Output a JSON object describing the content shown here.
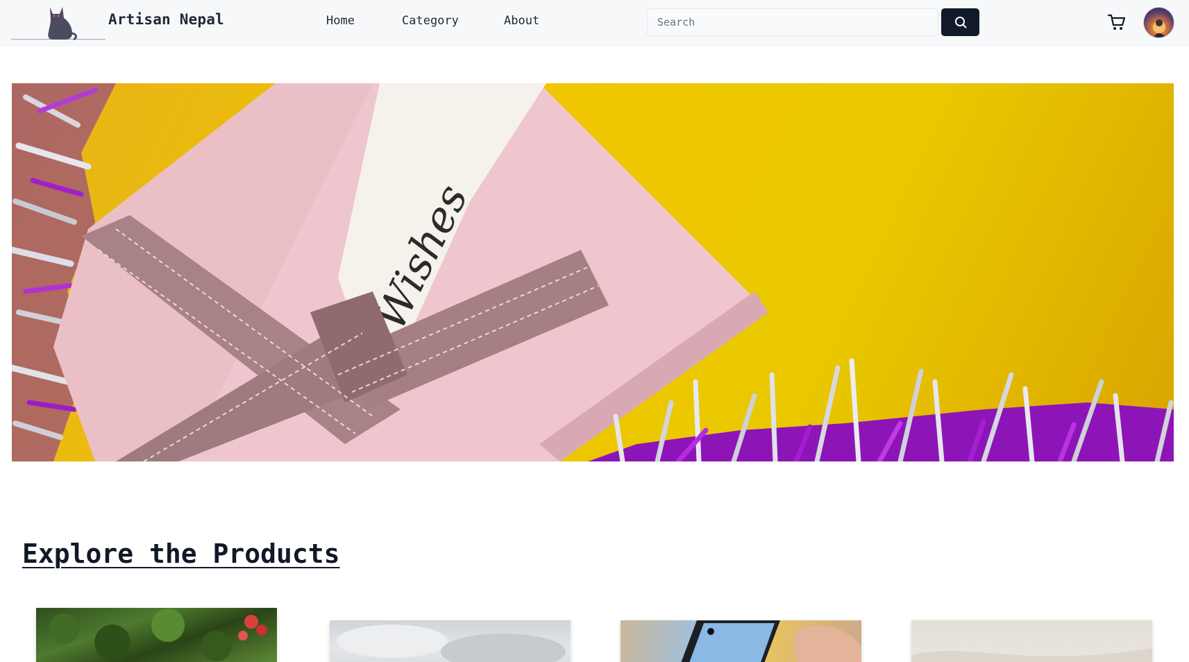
{
  "header": {
    "brand": "Artisan Nepal",
    "logo_icon": "cat-logo-icon",
    "nav": [
      {
        "label": "Home"
      },
      {
        "label": "Category"
      },
      {
        "label": "About"
      }
    ],
    "search": {
      "placeholder": "Search",
      "value": "",
      "button_icon": "search-icon"
    },
    "cart_icon": "cart-icon",
    "avatar_icon": "user-avatar"
  },
  "hero": {
    "image_text": "Wishes",
    "colors": {
      "background": "#f0c600",
      "box": "#efc4cc",
      "ribbon": "#a57f82",
      "tinsel": "#9b1fc7"
    }
  },
  "products_section": {
    "title": "Explore the Products",
    "cards": [
      {
        "image": "garden-flowers"
      },
      {
        "image": "cloudy-sky"
      },
      {
        "image": "phone-in-hand"
      },
      {
        "image": "light-fabric"
      }
    ]
  },
  "colors": {
    "accent": "#101a2b",
    "header_bg": "#f7f8fa",
    "text": "#1f2937"
  }
}
